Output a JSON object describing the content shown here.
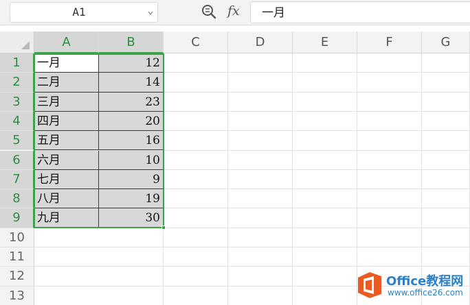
{
  "formula_bar": {
    "name_box": "A1",
    "formula": "一月",
    "fx_label": "fx"
  },
  "sheet": {
    "columns": [
      "A",
      "B",
      "C",
      "D",
      "E",
      "F",
      "G"
    ],
    "selected_columns": [
      "A",
      "B"
    ],
    "rows": [
      "1",
      "2",
      "3",
      "4",
      "5",
      "6",
      "7",
      "8",
      "9",
      "10",
      "11",
      "12",
      "13"
    ],
    "selected_rows": [
      "1",
      "2",
      "3",
      "4",
      "5",
      "6",
      "7",
      "8",
      "9"
    ],
    "data": [
      {
        "a": "一月",
        "b": "12"
      },
      {
        "a": "二月",
        "b": "14"
      },
      {
        "a": "三月",
        "b": "23"
      },
      {
        "a": "四月",
        "b": "20"
      },
      {
        "a": "五月",
        "b": "16"
      },
      {
        "a": "六月",
        "b": "10"
      },
      {
        "a": "七月",
        "b": "9"
      },
      {
        "a": "八月",
        "b": "19"
      },
      {
        "a": "九月",
        "b": "30"
      }
    ],
    "selection_color": "#3da14a"
  },
  "watermark": {
    "title": "Office教程网",
    "url": "www.office26.com",
    "brand_color": "#2a80c7",
    "logo_color": "#e85b24"
  }
}
